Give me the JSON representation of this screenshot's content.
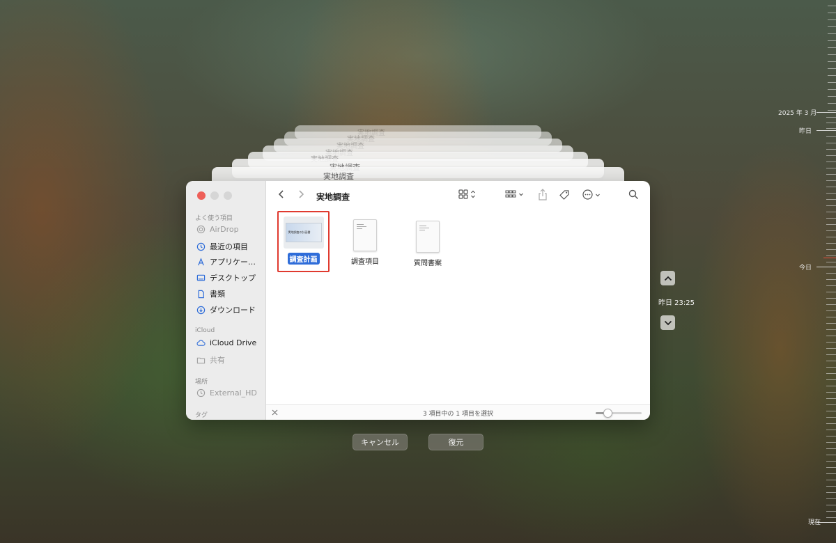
{
  "finder": {
    "title": "実地調査",
    "sidebar": {
      "favorites_header": "よく使う項目",
      "favorites": [
        {
          "label": "AirDrop",
          "icon": "airdrop-icon",
          "dim": true
        },
        {
          "label": "最近の項目",
          "icon": "clock-icon"
        },
        {
          "label": "アプリケー…",
          "icon": "applications-icon"
        },
        {
          "label": "デスクトップ",
          "icon": "desktop-icon"
        },
        {
          "label": "書類",
          "icon": "document-icon"
        },
        {
          "label": "ダウンロード",
          "icon": "download-icon"
        }
      ],
      "icloud_header": "iCloud",
      "icloud": [
        {
          "label": "iCloud Drive",
          "icon": "cloud-icon"
        },
        {
          "label": "共有",
          "icon": "shared-folder-icon",
          "dim": true
        }
      ],
      "locations_header": "場所",
      "locations": [
        {
          "label": "External_HD",
          "icon": "time-machine-icon",
          "dim": true
        }
      ],
      "tags_header": "タグ"
    },
    "files": [
      {
        "name": "調査計画",
        "selected": true,
        "thumbnail_text": "実地調査の計画書"
      },
      {
        "name": "調査項目",
        "selected": false
      },
      {
        "name": "質問書案",
        "selected": false
      }
    ],
    "status": "3 項目中の 1 項目を選択",
    "icon_size": 0.25
  },
  "stack_title": "実地調査",
  "buttons": {
    "cancel": "キャンセル",
    "restore": "復元"
  },
  "navigator": {
    "time": "昨日 23:25"
  },
  "timeline": {
    "labels": [
      "2025 年 3 月",
      "昨日",
      "今日",
      "現在"
    ]
  },
  "colors": {
    "selection": "#2f6dd9",
    "highlight_box": "#e03a2f",
    "accent_blue": "#2f6dd9",
    "timeline_marker": "#e74c3c"
  }
}
